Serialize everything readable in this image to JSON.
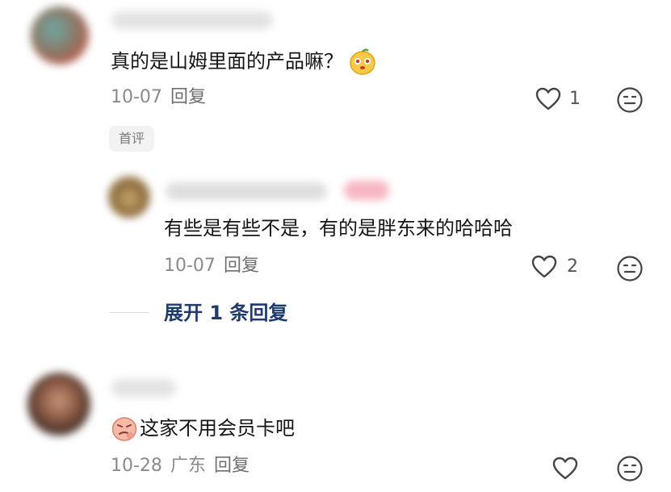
{
  "comments": [
    {
      "text": "真的是山姆里面的产品嘛？",
      "date": "10-07",
      "reply_label": "回复",
      "likes": "1",
      "badge": "首评",
      "emoji": "cute-face-emoji",
      "replies": [
        {
          "text": "有些是有些不是，有的是胖东来的哈哈哈",
          "date": "10-07",
          "reply_label": "回复",
          "likes": "2"
        }
      ],
      "expand_label": "展开 1 条回复"
    },
    {
      "text": "这家不用会员卡吧",
      "date": "10-28",
      "location": "广东",
      "reply_label": "回复",
      "emoji": "thinking-face-emoji"
    }
  ],
  "colors": {
    "link": "#1f3b6e",
    "meta": "#8a8a8a",
    "text": "#161616"
  }
}
